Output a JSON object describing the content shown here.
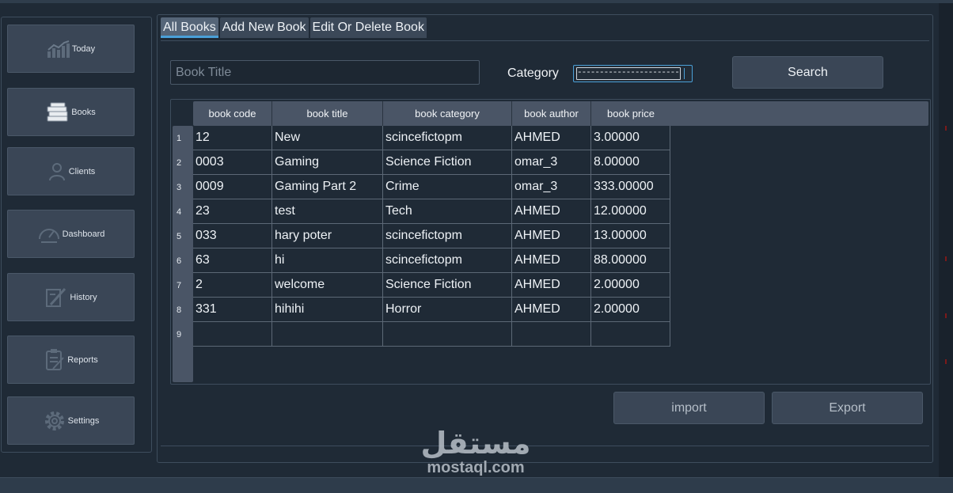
{
  "sidebar": {
    "items": [
      {
        "label": "Today",
        "icon": "chart-icon"
      },
      {
        "label": "Books",
        "icon": "books-icon"
      },
      {
        "label": "Clients",
        "icon": "user-icon"
      },
      {
        "label": "Dashboard",
        "icon": "gauge-icon"
      },
      {
        "label": "History",
        "icon": "pen-icon"
      },
      {
        "label": "Reports",
        "icon": "clipboard-icon"
      },
      {
        "label": "Settings",
        "icon": "gear-icon"
      }
    ]
  },
  "tabs": [
    {
      "label": "All Books",
      "active": true
    },
    {
      "label": "Add New Book",
      "active": false
    },
    {
      "label": "Edit Or Delete Book",
      "active": false
    }
  ],
  "search": {
    "title_placeholder": "Book Title",
    "category_label": "Category",
    "category_value": "------------------------------",
    "button_label": "Search"
  },
  "table": {
    "columns": [
      "book code",
      "book title",
      "book category",
      "book author",
      "book price"
    ],
    "row_numbers": [
      "1",
      "2",
      "3",
      "4",
      "5",
      "6",
      "7",
      "8",
      "9"
    ],
    "rows": [
      [
        "12",
        "New",
        "scincefictopm",
        "AHMED",
        "3.00000"
      ],
      [
        "0003",
        "Gaming",
        "Science Fiction",
        "omar_3",
        "8.00000"
      ],
      [
        "0009",
        "Gaming Part 2",
        "Crime",
        "omar_3",
        "333.00000"
      ],
      [
        "23",
        "test",
        "Tech",
        "AHMED",
        "12.00000"
      ],
      [
        "033",
        "hary poter",
        "scincefictopm",
        "AHMED",
        "13.00000"
      ],
      [
        "63",
        "hi",
        "scincefictopm",
        "AHMED",
        "88.00000"
      ],
      [
        "2",
        "welcome",
        "Science Fiction",
        "AHMED",
        "2.00000"
      ],
      [
        "331",
        "hihihi",
        "Horror",
        "AHMED",
        "2.00000"
      ],
      [
        "",
        "",
        "",
        "",
        ""
      ]
    ]
  },
  "actions": {
    "import_label": "import",
    "export_label": "Export"
  },
  "watermark": {
    "arabic": "مستقل",
    "latin": "mostaql.com"
  },
  "colors": {
    "background": "#1f2a36",
    "button": "#3a4656",
    "header": "#4a5566",
    "accent": "#4aa0d8"
  }
}
